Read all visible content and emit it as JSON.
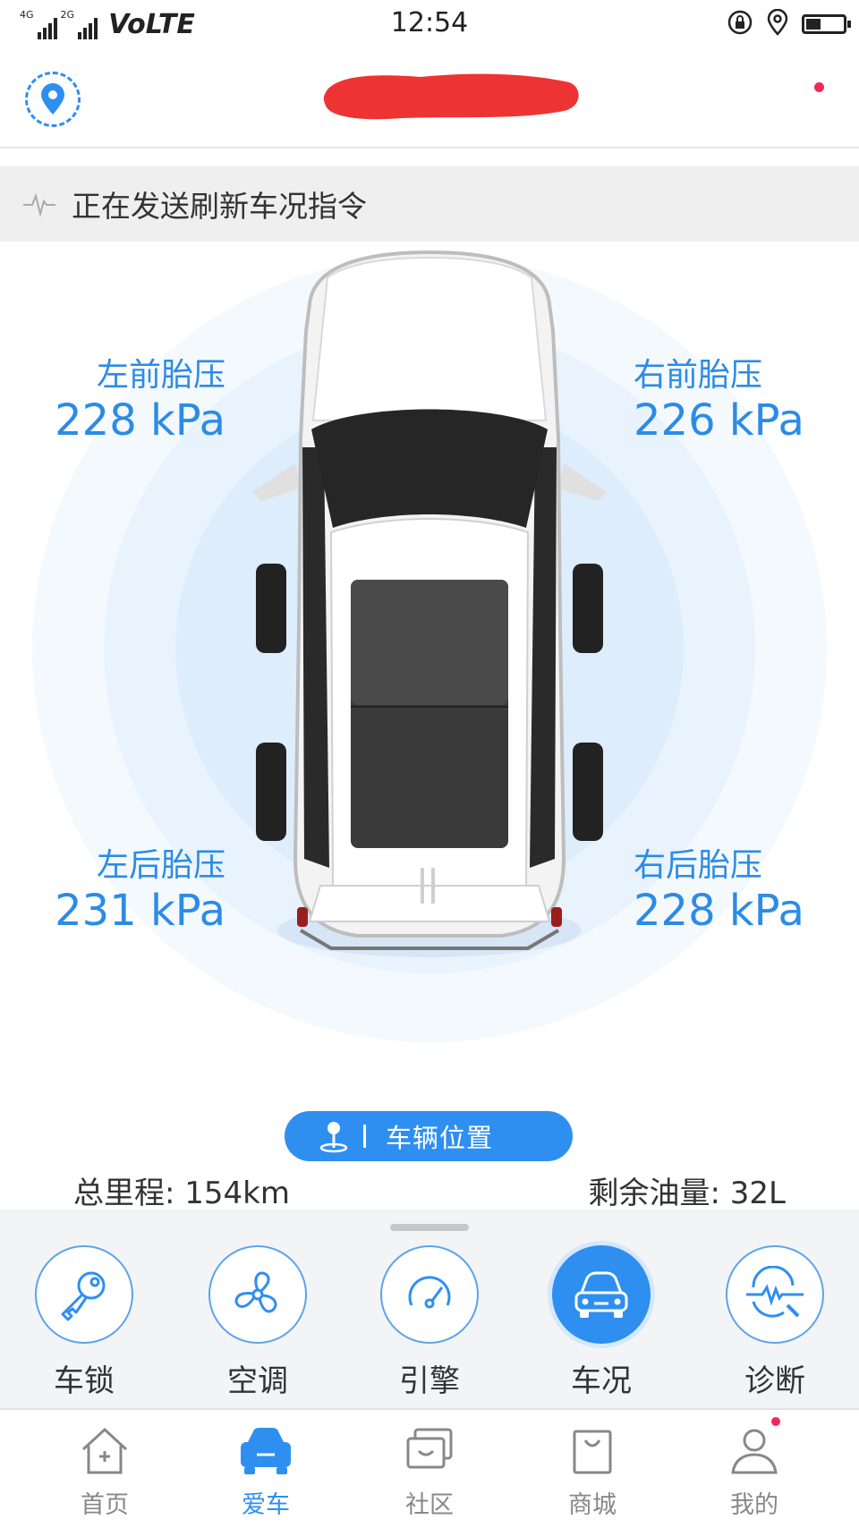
{
  "status_bar": {
    "network_1": "4G",
    "network_2": "2G",
    "carrier": "VoLTE",
    "time": "12:54",
    "battery_level": 0.4
  },
  "header": {
    "plate_redacted": true,
    "location_icon": "location-pin-icon"
  },
  "banner": {
    "text": "正在发送刷新车况指令",
    "icon": "pulse-icon"
  },
  "tires": {
    "front_left": {
      "label": "左前胎压",
      "value": "228 kPa"
    },
    "front_right": {
      "label": "右前胎压",
      "value": "226 kPa"
    },
    "rear_left": {
      "label": "左后胎压",
      "value": "231 kPa"
    },
    "rear_right": {
      "label": "右后胎压",
      "value": "228 kPa"
    }
  },
  "vehicle_location": {
    "label": "车辆位置",
    "icon": "map-pin-icon"
  },
  "stats": {
    "mileage": "总里程: 154km",
    "fuel": "剩余油量: 32L"
  },
  "functions": [
    {
      "label": "车锁",
      "icon": "key-icon",
      "active": false
    },
    {
      "label": "空调",
      "icon": "fan-icon",
      "active": false
    },
    {
      "label": "引擎",
      "icon": "gauge-icon",
      "active": false
    },
    {
      "label": "车况",
      "icon": "car-front-icon",
      "active": true
    },
    {
      "label": "诊断",
      "icon": "diagnosis-icon",
      "active": false
    }
  ],
  "tabs": [
    {
      "label": "首页",
      "icon": "home-icon",
      "active": false
    },
    {
      "label": "爱车",
      "icon": "car-icon",
      "active": true
    },
    {
      "label": "社区",
      "icon": "community-icon",
      "active": false
    },
    {
      "label": "商城",
      "icon": "shop-bag-icon",
      "active": false
    },
    {
      "label": "我的",
      "icon": "person-icon",
      "active": false,
      "badge": true
    }
  ],
  "colors": {
    "accent": "#2e8ff0",
    "tire_text": "#2c8be6",
    "badge": "#f2265a",
    "redaction": "#ee3333"
  }
}
